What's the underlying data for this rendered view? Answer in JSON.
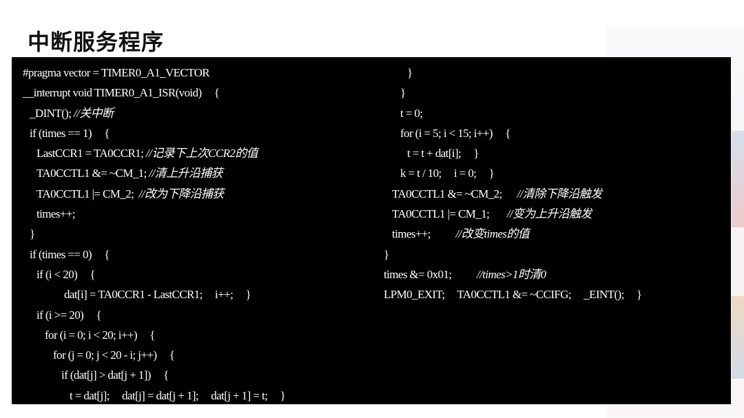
{
  "title": "中断服务程序",
  "code": {
    "left": [
      {
        "indent": 0,
        "code": "#pragma vector = TIMER0_A1_VECTOR",
        "comment": ""
      },
      {
        "indent": 0,
        "code": "__interrupt void TIMER0_A1_ISR(void)     {",
        "comment": ""
      },
      {
        "indent": 10,
        "code": "_DINT(); ",
        "comment": "//关中断"
      },
      {
        "indent": 10,
        "code": "if (times == 1)     {",
        "comment": ""
      },
      {
        "indent": 20,
        "code": "LastCCR1 = TA0CCR1; ",
        "comment": "//记录下上次CCR2的值"
      },
      {
        "indent": 20,
        "code": "TA0CCTL1 &= ~CM_1; ",
        "comment": "//清上升沿捕获"
      },
      {
        "indent": 20,
        "code": "TA0CCTL1 |= CM_2;  ",
        "comment": "//改为下降沿捕获"
      },
      {
        "indent": 20,
        "code": "times++;",
        "comment": ""
      },
      {
        "indent": 10,
        "code": "}",
        "comment": ""
      },
      {
        "indent": 10,
        "code": "if (times == 0)     {",
        "comment": ""
      },
      {
        "indent": 20,
        "code": "if (i < 20)     {",
        "comment": ""
      },
      {
        "indent": 60,
        "code": "dat[i] = TA0CCR1 - LastCCR1;     i++;     }",
        "comment": ""
      },
      {
        "indent": 20,
        "code": "if (i >= 20)     {",
        "comment": ""
      },
      {
        "indent": 32,
        "code": "for (i = 0; i < 20; i++)     {",
        "comment": ""
      },
      {
        "indent": 44,
        "code": "for (j = 0; j < 20 - i; j++)     {",
        "comment": ""
      },
      {
        "indent": 56,
        "code": "if (dat[j] > dat[j + 1])     {",
        "comment": ""
      },
      {
        "indent": 68,
        "code": "t = dat[j];     dat[j] = dat[j + 1];     dat[j + 1] = t;     }",
        "comment": ""
      }
    ],
    "right": [
      {
        "indent": 34,
        "code": "}",
        "comment": ""
      },
      {
        "indent": 24,
        "code": "}",
        "comment": ""
      },
      {
        "indent": 24,
        "code": "t = 0;",
        "comment": ""
      },
      {
        "indent": 24,
        "code": "for (i = 5; i < 15; i++)     {",
        "comment": ""
      },
      {
        "indent": 34,
        "code": "t = t + dat[i];     }",
        "comment": ""
      },
      {
        "indent": 24,
        "code": "k = t / 10;     i = 0;     }",
        "comment": ""
      },
      {
        "indent": 12,
        "code": "TA0CCTL1 &= ~CM_2;      ",
        "comment": "//清除下降沿触发"
      },
      {
        "indent": 12,
        "code": "TA0CCTL1 |= CM_1;       ",
        "comment": "//变为上升沿触发"
      },
      {
        "indent": 12,
        "code": "times++;          ",
        "comment": "//改变times的值"
      },
      {
        "indent": 0,
        "code": "}",
        "comment": ""
      },
      {
        "indent": 0,
        "code": "times &= 0x01;          ",
        "comment": "//times>1时清0"
      },
      {
        "indent": 0,
        "code": "LPM0_EXIT;     TA0CCTL1 &= ~CCIFG;     _EINT();     }",
        "comment": ""
      }
    ]
  }
}
